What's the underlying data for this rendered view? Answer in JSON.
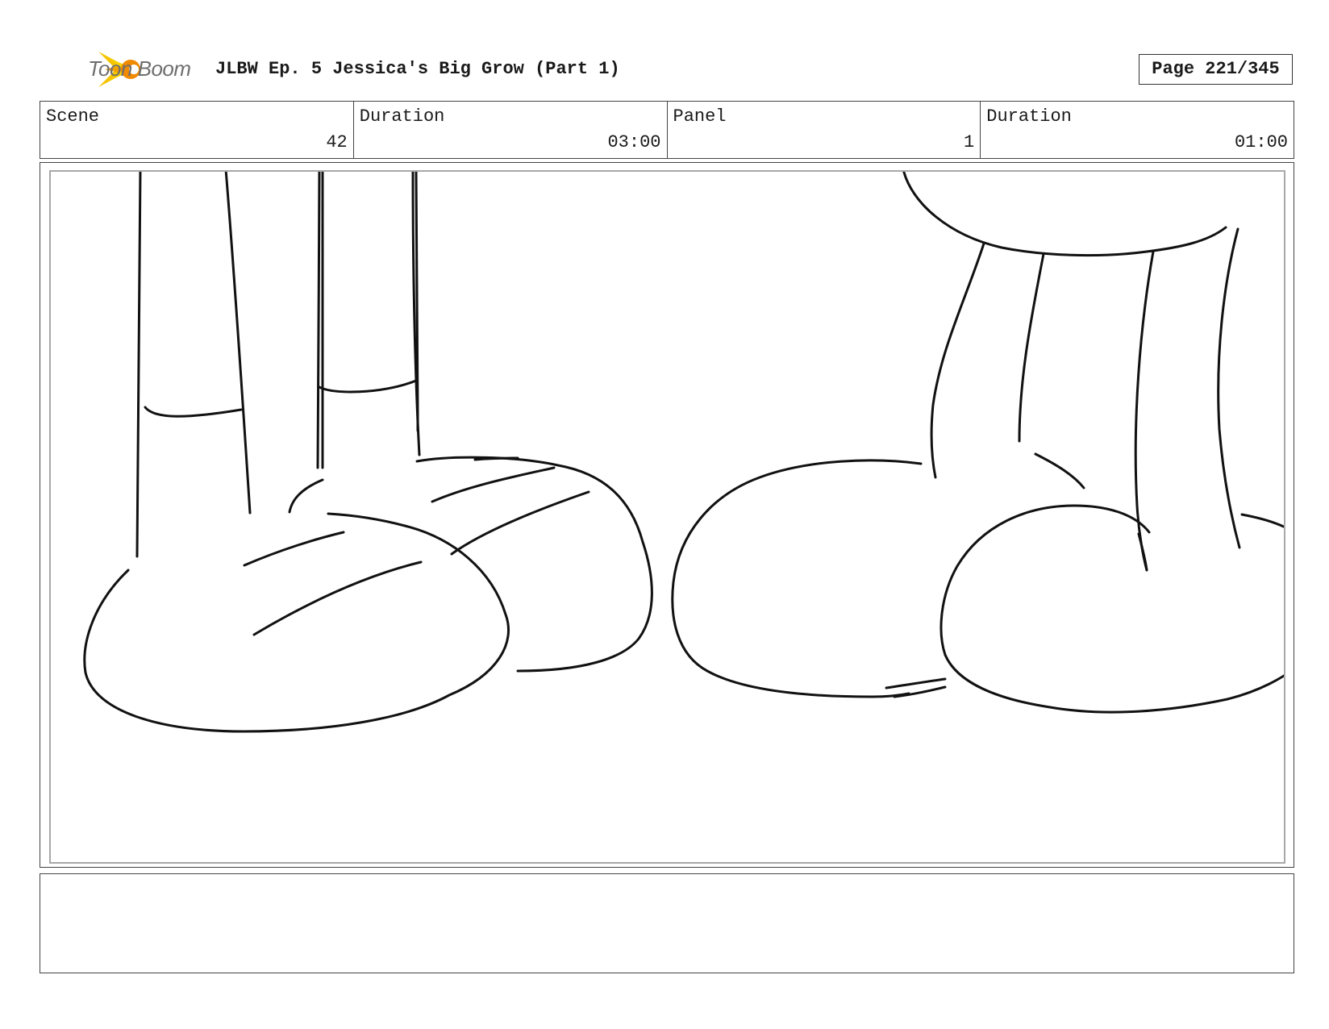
{
  "header": {
    "logo_text": "Toon Boom",
    "title": "JLBW Ep. 5 Jessica's Big Grow (Part 1)",
    "page": "Page 221/345"
  },
  "info": {
    "scene_label": "Scene",
    "scene_value": "42",
    "scene_duration_label": "Duration",
    "scene_duration_value": "03:00",
    "panel_label": "Panel",
    "panel_value": "1",
    "panel_duration_label": "Duration",
    "panel_duration_value": "01:00"
  },
  "panel": {
    "description": ""
  },
  "colors": {
    "logo_yellow": "#f5b800",
    "logo_orange": "#f08a00",
    "ink": "#111111",
    "frame_border": "#a8a8a8"
  }
}
